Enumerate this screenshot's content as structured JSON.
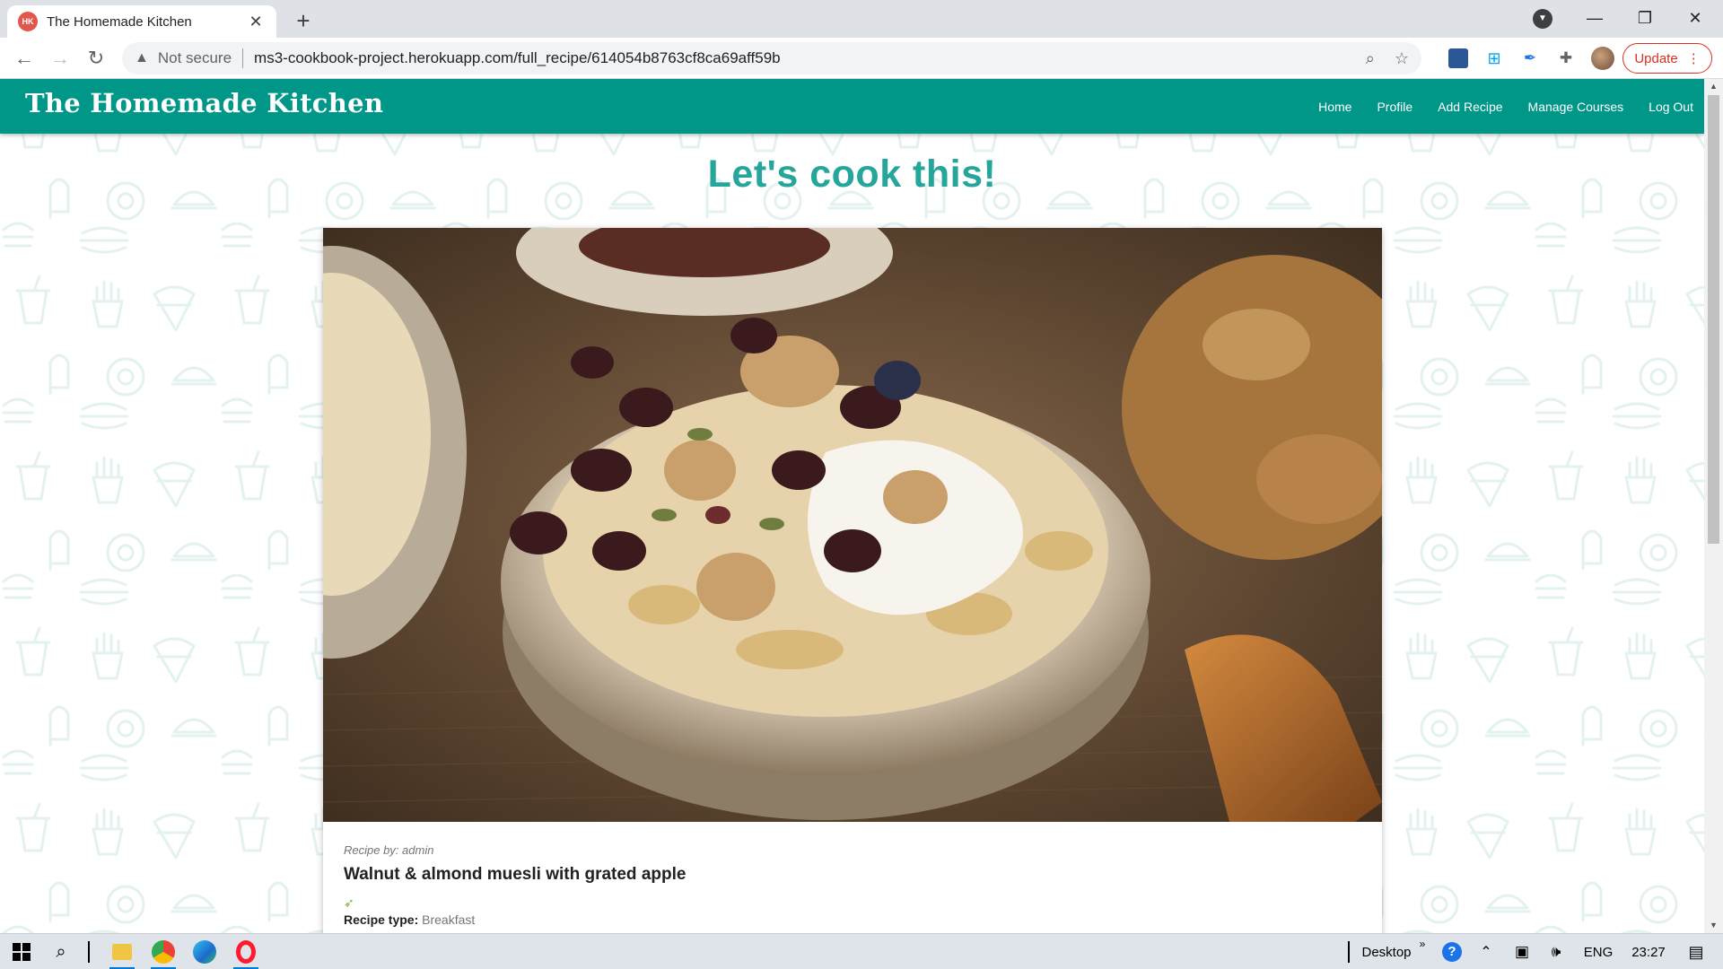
{
  "browser": {
    "tab_title": "The Homemade Kitchen",
    "favicon_text": "HK",
    "new_tab": "+",
    "security_label": "Not secure",
    "url": "ms3-cookbook-project.herokuapp.com/full_recipe/614054b8763cf8ca69aff59b",
    "update_label": "Update"
  },
  "site": {
    "brand": "The Homemade Kitchen",
    "nav": [
      "Home",
      "Profile",
      "Add Recipe",
      "Manage Courses",
      "Log Out"
    ],
    "heading": "Let's cook this!"
  },
  "recipe": {
    "author": "Recipe by: admin",
    "title": "Walnut & almond muesli with grated apple",
    "type_label": "Recipe type:",
    "type_value": "Breakfast"
  },
  "taskbar": {
    "desktop_label": "Desktop",
    "language": "ENG",
    "time": "23:27"
  },
  "colors": {
    "navbar": "#009688",
    "heading": "#26a69a",
    "update": "#d93025"
  }
}
